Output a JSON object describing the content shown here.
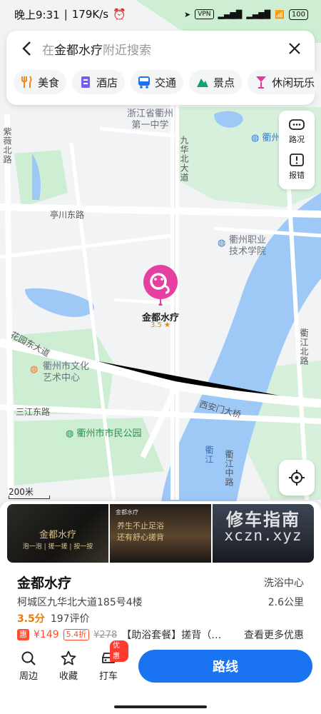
{
  "status_bar": {
    "time": "晚上9:31",
    "speed": "179K/s",
    "vpn": "VPN",
    "battery": "100"
  },
  "search": {
    "prefix": "在",
    "keyword": "金都水疗",
    "suffix": "附近搜索"
  },
  "categories": [
    {
      "label": "美食",
      "icon": "fork-knife-icon",
      "color": "#f08a1c"
    },
    {
      "label": "酒店",
      "icon": "hotel-icon",
      "color": "#7a5cf0"
    },
    {
      "label": "交通",
      "icon": "bus-icon",
      "color": "#1a73f0"
    },
    {
      "label": "景点",
      "icon": "mountain-icon",
      "color": "#14a46b"
    },
    {
      "label": "休闲玩乐",
      "icon": "cocktail-icon",
      "color": "#e6399b"
    }
  ],
  "tools": {
    "traffic": "路况",
    "report": "报错"
  },
  "map": {
    "scale": "200米",
    "labels": {
      "school1": "浙江省衢州\n第一中学",
      "quzhou": "衢州",
      "road_jiuhua": "九华北大道",
      "road_tingchuan": "亭川东路",
      "vocational": "衢州职业\n技术学院",
      "road_ziwei": "紫薇北路",
      "road_huayuan": "花园东大道",
      "culture": "衢州市文化\n艺术中心",
      "road_sanjiang": "三江东路",
      "park": "衢州市市民公园",
      "road_xianmen": "西安门大桥",
      "road_qujiang": "衢江北路",
      "river": "衢江",
      "road_qujiangzhong": "衢江中路"
    },
    "pin": {
      "name": "金都水疗",
      "rating": "3.5 ★"
    }
  },
  "poi": {
    "name": "金都水疗",
    "type": "洗浴中心",
    "address": "柯城区九华北大道185号4楼",
    "distance": "2.6公里",
    "score": "3.5分",
    "reviews": "197评价",
    "deal_tag": "惠",
    "price": "¥149",
    "discount": "5.4折",
    "old_price": "¥278",
    "deal_desc": "【助浴套餐】搓背（…",
    "more_deals": "查看更多优惠",
    "photo1_title": "金都水疗",
    "photo1_sub": "泡一泡 | 搓一搓 | 按一按",
    "photo2_title": "金都水疗",
    "photo2_line1": "养生不止足浴",
    "photo2_line2": "还有舒心搓背",
    "watermark_cn": "修车指南",
    "watermark_en": "xczn.xyz"
  },
  "actions": {
    "nearby": "周边",
    "favorite": "收藏",
    "taxi": "打车",
    "taxi_badge": "优惠",
    "route": "路线"
  }
}
